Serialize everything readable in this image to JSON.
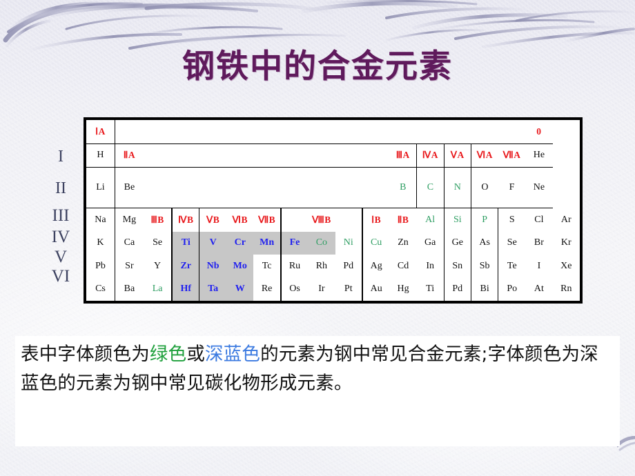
{
  "slide": {
    "title": "钢铁中的合金元素",
    "title_color": "#5f1a5c",
    "background_color": "#eeeef4"
  },
  "period_labels": [
    "I",
    "II",
    "III",
    "IV",
    "V",
    "VI"
  ],
  "periodic_table": {
    "group_header_color": "#e8191c",
    "green_color": "#2f9e63",
    "blue_color": "#2222ef",
    "shade_color": "#c7c7c7",
    "group_zero": "0",
    "groups": {
      "IA": "ⅠA",
      "IIA": "ⅡA",
      "IIIB": "ⅢB",
      "IVB": "ⅣB",
      "VB": "ⅤB",
      "VIB": "ⅥB",
      "VIIB": "ⅦB",
      "VIIIB": "ⅧB",
      "IB": "ⅠB",
      "IIB": "ⅡB",
      "IIIA": "ⅢA",
      "IVA": "ⅣA",
      "VA": "ⅤA",
      "VIA": "ⅥA",
      "VIIA": "ⅦA"
    },
    "rows": {
      "row1": [
        "H",
        "He"
      ],
      "row2": [
        "Li",
        "Be",
        "B",
        "C",
        "N",
        "O",
        "F",
        "Ne"
      ],
      "row4": [
        "Na",
        "Mg",
        "Al",
        "Si",
        "P",
        "S",
        "Cl",
        "Ar"
      ],
      "row5": [
        "K",
        "Ca",
        "Se",
        "Ti",
        "V",
        "Cr",
        "Mn",
        "Fe",
        "Co",
        "Ni",
        "Cu",
        "Zn",
        "Ga",
        "Ge",
        "As",
        "Se",
        "Br",
        "Kr"
      ],
      "row6": [
        "Pb",
        "Sr",
        "Y",
        "Zr",
        "Nb",
        "Mo",
        "Tc",
        "Ru",
        "Rh",
        "Pd",
        "Ag",
        "Cd",
        "In",
        "Sn",
        "Sb",
        "Te",
        "I",
        "Xe"
      ],
      "row7": [
        "Cs",
        "Ba",
        "La",
        "Hf",
        "Ta",
        "W",
        "Re",
        "Os",
        "Ir",
        "Pt",
        "Au",
        "Hg",
        "Ti",
        "Pd",
        "Bi",
        "Po",
        "At",
        "Rn"
      ]
    },
    "elements": {
      "H": "H",
      "He": "He",
      "Li": "Li",
      "Be": "Be",
      "B": "B",
      "C": "C",
      "N": "N",
      "O": "O",
      "F": "F",
      "Ne": "Ne",
      "Na": "Na",
      "Mg": "Mg",
      "Al": "Al",
      "Si": "Si",
      "P": "P",
      "S": "S",
      "Cl": "Cl",
      "Ar": "Ar",
      "K": "K",
      "Ca": "Ca",
      "Sc": "Se",
      "Ti": "Ti",
      "V": "V",
      "Cr": "Cr",
      "Mn": "Mn",
      "Fe": "Fe",
      "Co": "Co",
      "Ni": "Ni",
      "Cu": "Cu",
      "Zn": "Zn",
      "Ga": "Ga",
      "Ge": "Ge",
      "As": "As",
      "Se": "Se",
      "Br": "Br",
      "Kr": "Kr",
      "Rb": "Pb",
      "Sr": "Sr",
      "Y": "Y",
      "Zr": "Zr",
      "Nb": "Nb",
      "Mo": "Mo",
      "Tc": "Tc",
      "Ru": "Ru",
      "Rh": "Rh",
      "Pd": "Pd",
      "Ag": "Ag",
      "Cd": "Cd",
      "In": "In",
      "Sn": "Sn",
      "Sb": "Sb",
      "Te": "Te",
      "I": "I",
      "Xe": "Xe",
      "Cs": "Cs",
      "Ba": "Ba",
      "La": "La",
      "Hf": "Hf",
      "Ta": "Ta",
      "W": "W",
      "Re": "Re",
      "Os": "Os",
      "Ir": "Ir",
      "Pt": "Pt",
      "Au": "Au",
      "Hg": "Hg",
      "Tl": "Ti",
      "Pb6": "Pd",
      "Bi": "Bi",
      "Po": "Po",
      "At": "At",
      "Rn": "Rn"
    }
  },
  "caption": {
    "part1": "表中字体颜色为",
    "green_word": "绿色",
    "part2": "或",
    "blue_word": "深蓝色",
    "part3": "的元素为钢中常见合金元素;字体颜色为深蓝色的元素为钢中常见碳化物形成元素。"
  }
}
